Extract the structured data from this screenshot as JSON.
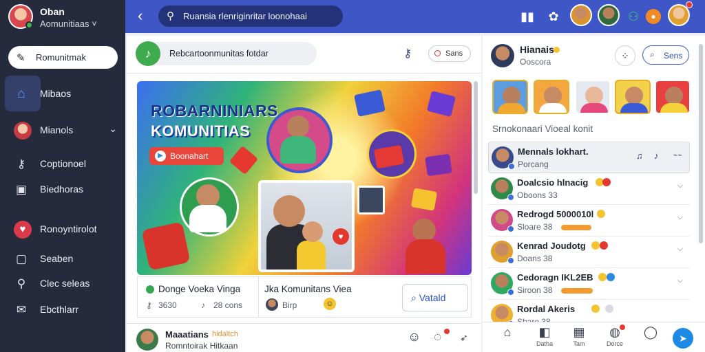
{
  "sidebar": {
    "profile_name": "Oban",
    "profile_sub": "Aomunitiaas",
    "profile_menu": "˅",
    "search_label": "Romunitmak",
    "items": [
      {
        "label": "Mibaos"
      },
      {
        "label": "Mianols"
      },
      {
        "label": "Coptionoel"
      },
      {
        "label": "Biedhoras"
      },
      {
        "label": "Ronoyntirolot"
      },
      {
        "label": "Seaben"
      },
      {
        "label": "Clec seleas"
      },
      {
        "label": "Ebcthlarr"
      }
    ]
  },
  "topbar": {
    "search_value": "Ruansia rlenriginritar loonohaai"
  },
  "composer": {
    "placeholder": "Rebcartoonmunitas fotdar",
    "button_label": "Sans"
  },
  "banner": {
    "title_line1": "ROBARNINIARS",
    "title_line2": "KOMUNITIAS",
    "button_label": "Boonahart"
  },
  "card": {
    "left_title": "Donge Voeka Vinga",
    "left_stat1": "3630",
    "left_stat2": "28 cons",
    "mid_title": "Jka Komunitans Viea",
    "mid_sub": "Birp",
    "visual_btn": "Vatald"
  },
  "footer": {
    "name": "Maaatians",
    "tag": "hidaltch",
    "sub": "Romntoirak Hitkaan"
  },
  "right": {
    "user_name": "Hianais",
    "user_sub": "Ooscora",
    "send_label": "Sens",
    "section_title": "Srnokonaari Vioeal konit",
    "rows": [
      {
        "name": "Mennals lokhart.",
        "sub": "Porcang"
      },
      {
        "name": "Doalcsio hlnacig",
        "sub": "Oboons 33"
      },
      {
        "name": "Redrogd 5000010l",
        "sub": "Sloare 38"
      },
      {
        "name": "Kenrad Joudotg",
        "sub": "Doans 38"
      },
      {
        "name": "Cedoragn IKL2EB",
        "sub": "Siroon 38"
      },
      {
        "name": "Rordal Akeris",
        "sub": "Sbare 38"
      }
    ],
    "nav": [
      {
        "label": ""
      },
      {
        "label": "Datha"
      },
      {
        "label": "Tam"
      },
      {
        "label": "Dorce"
      },
      {
        "label": ""
      }
    ]
  },
  "colors": {
    "sidebar_bg": "#252a3c",
    "topbar_bg": "#3e56c6",
    "accent": "#3e56c6"
  },
  "icons": [
    "home-icon",
    "search-icon",
    "key-icon",
    "tv-icon",
    "heart-icon",
    "bag-icon",
    "wrench-icon",
    "mail-icon",
    "back-icon",
    "bell-icon",
    "gear-icon",
    "send-icon",
    "chat-icon",
    "smile-icon"
  ]
}
